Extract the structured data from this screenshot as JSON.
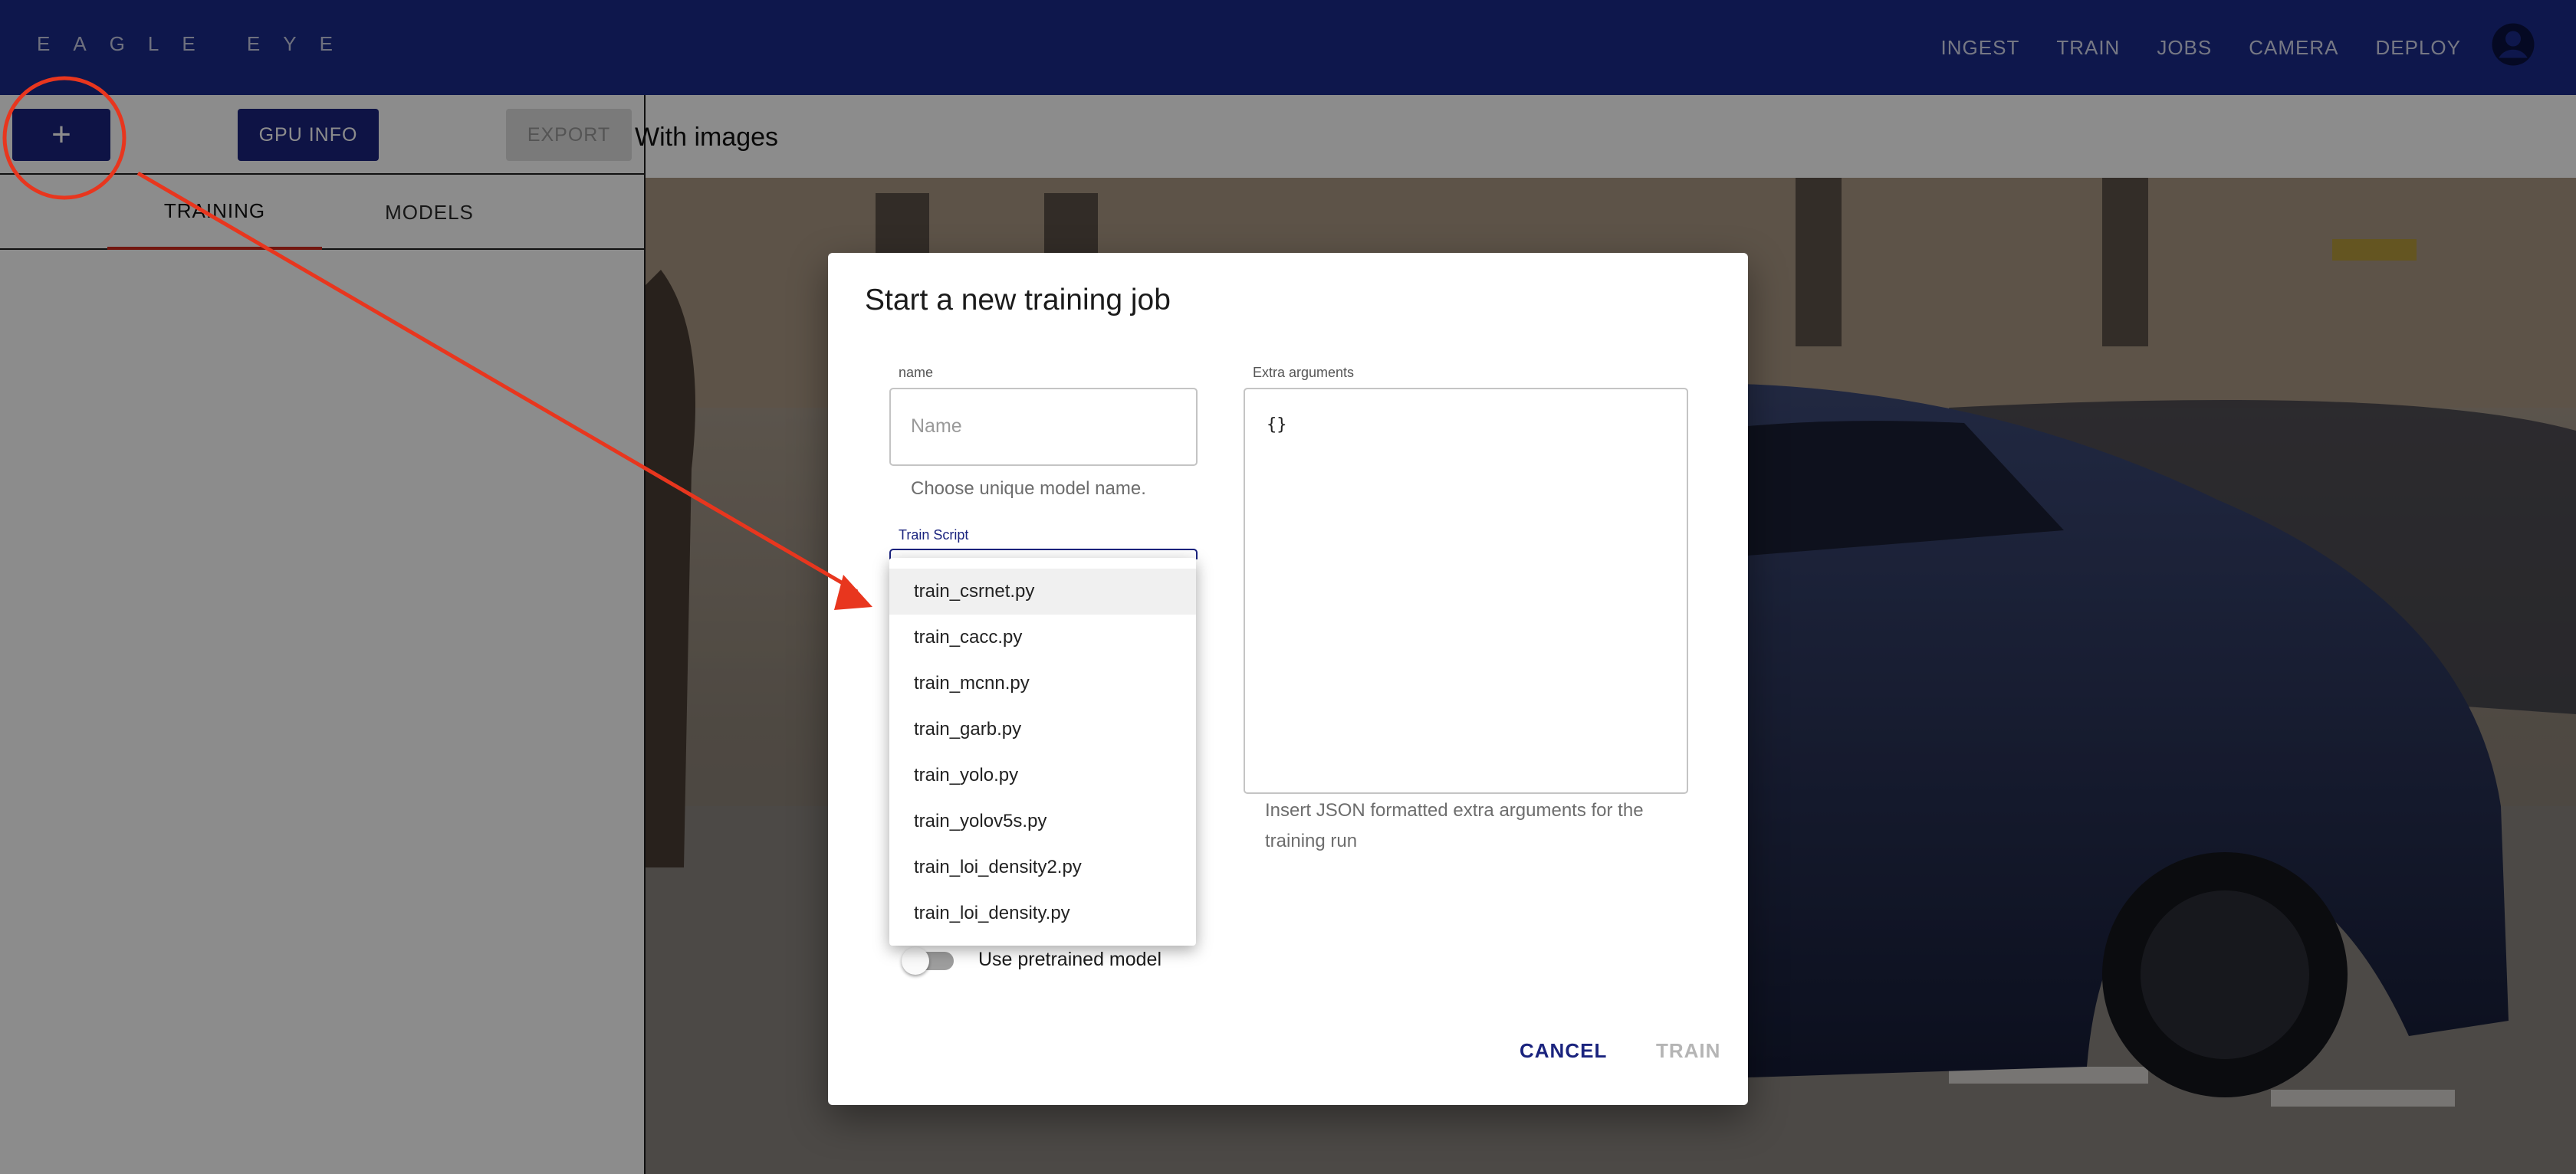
{
  "app": {
    "brand": "EAGLE EYE"
  },
  "nav": {
    "items": [
      "INGEST",
      "TRAIN",
      "JOBS",
      "CAMERA",
      "DEPLOY"
    ]
  },
  "left_panel": {
    "add_label": "+",
    "gpu_label": "GPU INFO",
    "export_label": "EXPORT",
    "tabs": [
      "TRAINING",
      "MODELS"
    ]
  },
  "main": {
    "subtitle": "With images"
  },
  "dialog": {
    "title": "Start a new training job",
    "name_field": {
      "label": "name",
      "placeholder": "Name",
      "helper": "Choose unique model name."
    },
    "train_script": {
      "label": "Train Script"
    },
    "extra_args": {
      "label": "Extra arguments",
      "value": "{}",
      "helper": "Insert JSON formatted extra arguments for the training run"
    },
    "pretrained_label": "Use pretrained model",
    "cancel_label": "CANCEL",
    "train_label": "TRAIN"
  },
  "dropdown": {
    "options": [
      "train_csrnet.py",
      "train_cacc.py",
      "train_mcnn.py",
      "train_garb.py",
      "train_yolo.py",
      "train_yolov5s.py",
      "train_loi_density2.py",
      "train_loi_density.py"
    ],
    "highlighted": "train_csrnet.py"
  },
  "colors": {
    "primary": "#1a237e",
    "topbar": "#1a2a8a",
    "annotation": "#e8361e",
    "tab_indicator": "#d22b1e"
  },
  "icons": {
    "avatar": "account-circle-icon"
  }
}
